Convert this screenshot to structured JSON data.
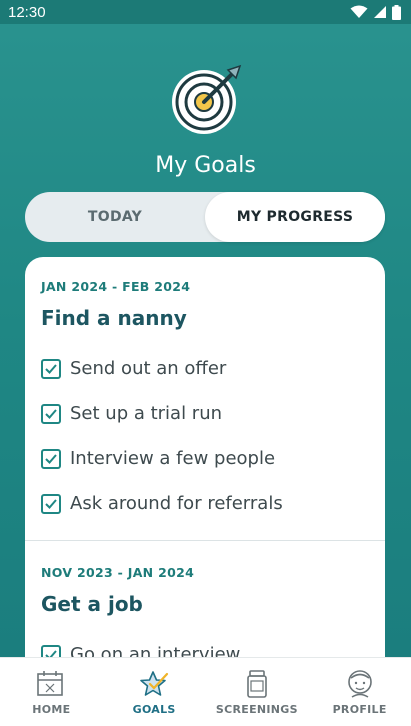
{
  "status_bar": {
    "time": "12:30"
  },
  "header": {
    "title": "My Goals"
  },
  "tabs": [
    {
      "label": "TODAY",
      "active": false
    },
    {
      "label": "MY PROGRESS",
      "active": true
    }
  ],
  "goals": [
    {
      "date_range": "JAN 2024 - FEB 2024",
      "title": "Find a nanny",
      "tasks": [
        {
          "label": "Send out an offer",
          "checked": true
        },
        {
          "label": "Set up a trial run",
          "checked": true
        },
        {
          "label": "Interview a few people",
          "checked": true
        },
        {
          "label": "Ask around for referrals",
          "checked": true
        }
      ]
    },
    {
      "date_range": "NOV 2023 - JAN 2024",
      "title": "Get a job",
      "tasks": [
        {
          "label": "Go on an interview",
          "checked": true
        }
      ]
    }
  ],
  "bottom_nav": [
    {
      "label": "HOME",
      "icon": "calendar-icon",
      "active": false
    },
    {
      "label": "GOALS",
      "icon": "star-check-icon",
      "active": true
    },
    {
      "label": "SCREENINGS",
      "icon": "clipboard-jar-icon",
      "active": false
    },
    {
      "label": "PROFILE",
      "icon": "person-icon",
      "active": false
    }
  ],
  "colors": {
    "teal": "#1f8784",
    "title_teal": "#1d5661",
    "active_nav": "#1f6f85"
  }
}
